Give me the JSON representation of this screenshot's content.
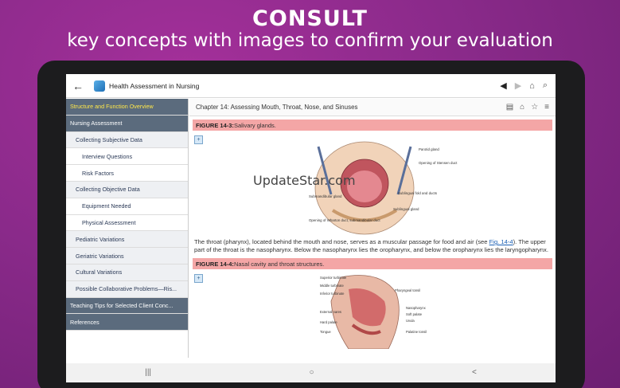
{
  "promo": {
    "headline": "CONSULT",
    "subline": "key concepts with images to confirm your evaluation"
  },
  "appbar": {
    "title": "Health Assessment in Nursing",
    "back_icon": "←",
    "prev_icon": "◀",
    "next_icon": "▶",
    "home_icon": "⌂",
    "search_icon": "⌕"
  },
  "sidebar": {
    "items": [
      {
        "label": "Structure and Function Overview",
        "level": 0
      },
      {
        "label": "Nursing Assessment",
        "level": 0
      },
      {
        "label": "Collecting Subjective Data",
        "level": 1
      },
      {
        "label": "Interview Questions",
        "level": 2
      },
      {
        "label": "Risk Factors",
        "level": 2
      },
      {
        "label": "Collecting Objective Data",
        "level": 1
      },
      {
        "label": "Equipment Needed",
        "level": 2
      },
      {
        "label": "Physical Assessment",
        "level": 2
      },
      {
        "label": "Pediatric Variations",
        "level": 1
      },
      {
        "label": "Geriatric Variations",
        "level": 1
      },
      {
        "label": "Cultural Variations",
        "level": 1
      },
      {
        "label": "Possible Collaborative Problems—Ris...",
        "level": 1
      },
      {
        "label": "Teaching Tips for Selected Client Conc...",
        "level": 0
      },
      {
        "label": "References",
        "level": 0
      }
    ]
  },
  "content": {
    "chapter": "Chapter 14: Assessing Mouth, Throat, Nose, and Sinuses",
    "figure1": {
      "label": "FIGURE 14-3:",
      "caption": " Salivary glands.",
      "labels": {
        "parotid": "Parotid gland",
        "stensen": "Opening of Stensen duct",
        "submandibular": "Submandibular gland",
        "sublingual_ducts": "Sublingual fold and ducts",
        "sublingual": "Sublingual gland",
        "wharton": "Opening of Wharton duct, submandibular duct"
      }
    },
    "watermark": "UpdateStar.com",
    "paragraph_before": "The throat (pharynx), located behind the mouth and nose, serves as a muscular passage for food and air (see ",
    "paragraph_link": "Fig. 14-4",
    "paragraph_after": "). The upper part of the throat is the nasopharynx. Below the nasopharynx lies the oropharynx, and below the oropharynx lies the laryngopharynx.",
    "figure2": {
      "label": "FIGURE 14-4:",
      "caption": " Nasal cavity and throat structures.",
      "labels": {
        "superior": "Superior turbinate",
        "middle": "Middle turbinate",
        "inferior": "Inferior turbinate",
        "external": "External nares",
        "hard_palate": "Hard palate",
        "tongue": "Tongue",
        "pharyngeal_tonsil": "Pharyngeal tonsil",
        "nasopharynx": "Nasopharynx",
        "soft_palate": "Soft palate",
        "uvula": "Uvula",
        "palatine_tonsil": "Palatine tonsil"
      }
    }
  },
  "system_nav": {
    "recents": "|||",
    "home": "○",
    "back": "<"
  }
}
